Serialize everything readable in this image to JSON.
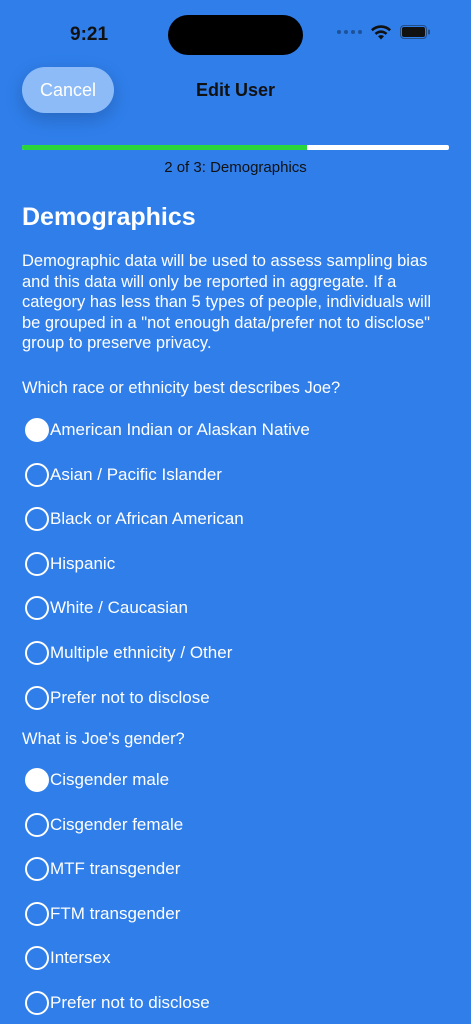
{
  "status_bar": {
    "time": "9:21",
    "icons": [
      "cellular-dots-icon",
      "wifi-icon",
      "battery-icon"
    ]
  },
  "nav": {
    "cancel_label": "Cancel",
    "title": "Edit User"
  },
  "progress": {
    "fraction": 0.667,
    "label": "2 of 3: Demographics",
    "fill_color": "#2bd63c"
  },
  "section": {
    "title": "Demographics",
    "description": "Demographic data will be used to assess sampling bias and this data will only be reported in aggregate. If a category has less than 5 types of people, individuals will be grouped in a \"not enough data/prefer not to disclose\" group to preserve privacy."
  },
  "race_question": {
    "label": "Which race or ethnicity best describes Joe?",
    "options": [
      {
        "label": "American Indian or Alaskan Native",
        "selected": true
      },
      {
        "label": "Asian / Pacific Islander",
        "selected": false
      },
      {
        "label": "Black or African American",
        "selected": false
      },
      {
        "label": "Hispanic",
        "selected": false
      },
      {
        "label": "White / Caucasian",
        "selected": false
      },
      {
        "label": "Multiple ethnicity / Other",
        "selected": false
      },
      {
        "label": "Prefer not to disclose",
        "selected": false
      }
    ]
  },
  "gender_question": {
    "label": "What is Joe's gender?",
    "options": [
      {
        "label": "Cisgender male",
        "selected": true
      },
      {
        "label": "Cisgender female",
        "selected": false
      },
      {
        "label": "MTF transgender",
        "selected": false
      },
      {
        "label": "FTM transgender",
        "selected": false
      },
      {
        "label": "Intersex",
        "selected": false
      },
      {
        "label": "Prefer not to disclose",
        "selected": false
      }
    ]
  },
  "colors": {
    "background": "#2f7eea",
    "text": "#ffffff"
  }
}
